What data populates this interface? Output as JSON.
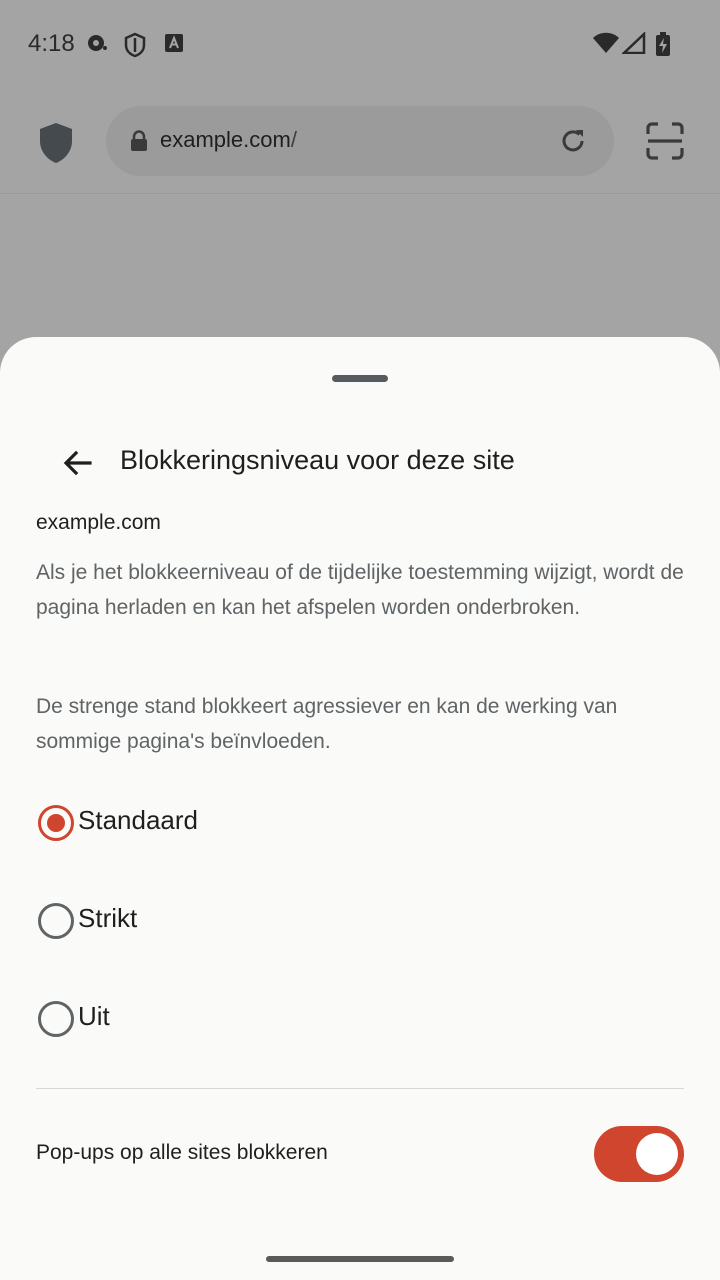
{
  "status_bar": {
    "time": "4:18",
    "icons_left": [
      "media-icon",
      "vpn-shield-icon",
      "keyboard-a-icon"
    ],
    "icons_right": [
      "wifi-icon",
      "signal-icon",
      "battery-charging-icon"
    ]
  },
  "toolbar": {
    "url_domain": "example.com",
    "url_path": "/",
    "icons": [
      "shield-icon",
      "lock-icon",
      "reload-icon",
      "scan-icon"
    ]
  },
  "sheet": {
    "title": "Blokkeringsniveau voor deze site",
    "site": "example.com",
    "paragraph1": "Als je het blokkeerniveau of de tijdelijke toestemming wijzigt, wordt de pagina herladen en kan het afspelen worden onderbroken.",
    "paragraph2": "De strenge stand blokkeert agressiever en kan de werking van sommige pagina's beïnvloeden.",
    "options": [
      {
        "label": "Standaard",
        "selected": true
      },
      {
        "label": "Strikt",
        "selected": false
      },
      {
        "label": "Uit",
        "selected": false
      }
    ],
    "popup_label": "Pop-ups op alle sites blokkeren",
    "popup_enabled": true
  },
  "colors": {
    "accent": "#d0452d",
    "scrim": "#a4a4a4",
    "sheet_bg": "#fafaf8",
    "secondary_text": "#5f6466"
  }
}
